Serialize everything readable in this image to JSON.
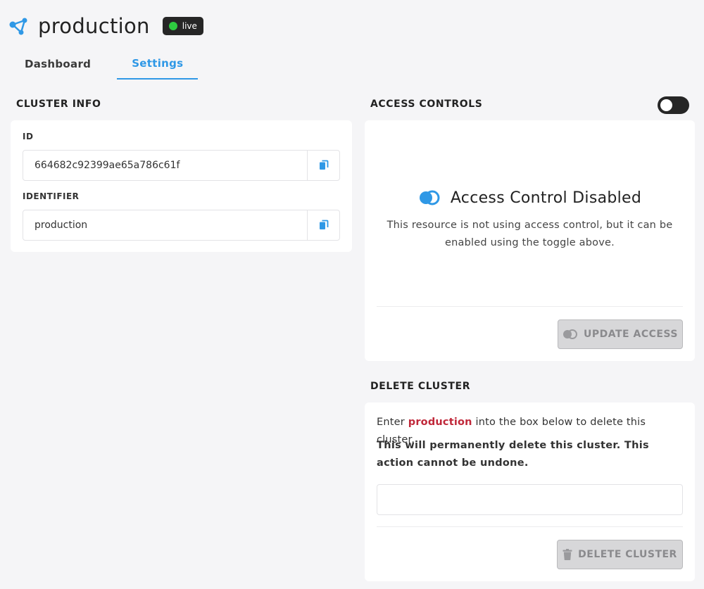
{
  "header": {
    "title": "production",
    "status": "live"
  },
  "tabs": [
    {
      "label": "Dashboard"
    },
    {
      "label": "Settings"
    }
  ],
  "cluster_info": {
    "title": "CLUSTER INFO",
    "id_label": "ID",
    "id_value": "664682c92399ae65a786c61f",
    "identifier_label": "IDENTIFIER",
    "identifier_value": "production"
  },
  "access_controls": {
    "title": "ACCESS CONTROLS",
    "heading": "Access Control Disabled",
    "description": "This resource is not using access control, but it can be enabled using the toggle above.",
    "button": "UPDATE ACCESS"
  },
  "delete_cluster": {
    "title": "DELETE CLUSTER",
    "prompt_before": "Enter ",
    "cluster_name": "production",
    "prompt_after": " into the box below to delete this cluster.",
    "warning": "This will permanently delete this cluster. This action cannot be undone.",
    "input_value": "",
    "button": "DELETE CLUSTER"
  },
  "colors": {
    "accent": "#2f98e6",
    "live": "#2ecc40",
    "danger_text": "#c0283a"
  }
}
